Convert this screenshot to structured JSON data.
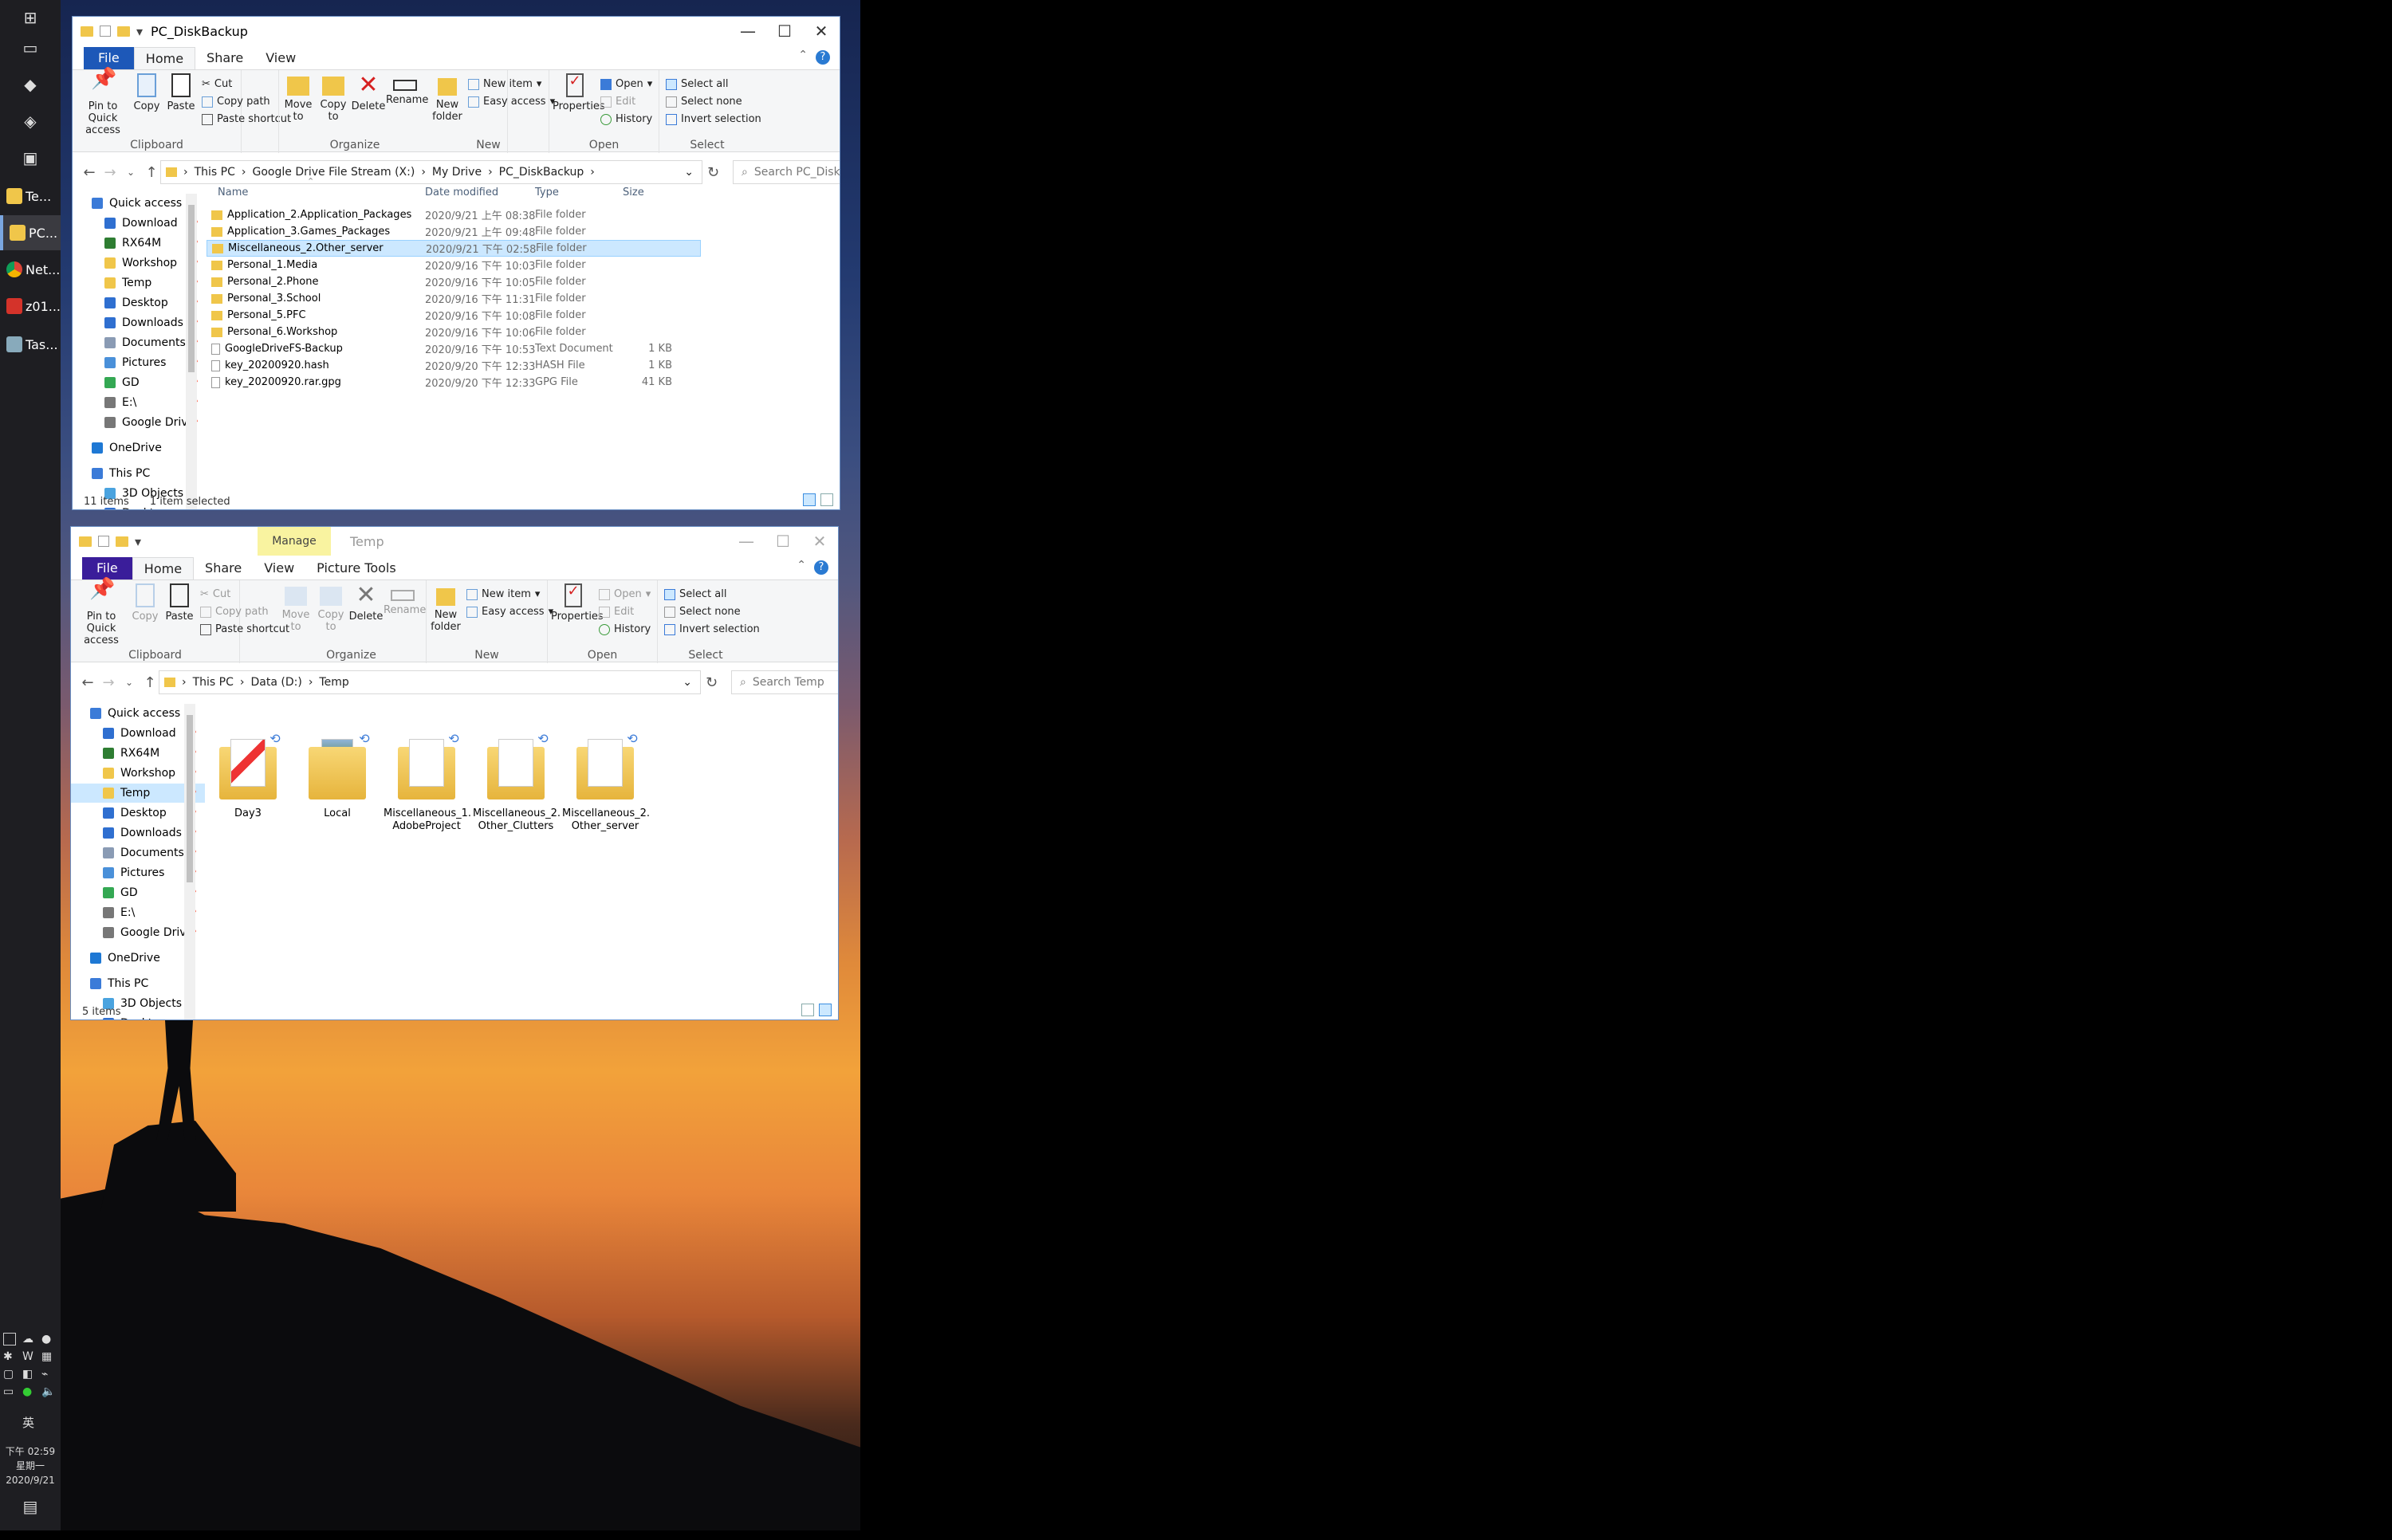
{
  "taskbar": {
    "apps": [
      {
        "label": "Te...",
        "icon": "folder-icon"
      },
      {
        "label": "PC...",
        "icon": "folder-icon"
      },
      {
        "label": "Net...",
        "icon": "chrome-icon"
      },
      {
        "label": "z01...",
        "icon": "pdf-icon"
      },
      {
        "label": "Tas...",
        "icon": "task-manager-icon"
      }
    ],
    "clock": {
      "time": "下午 02:59",
      "day": "星期一",
      "date": "2020/9/21"
    },
    "ime": "英"
  },
  "window1": {
    "title": "PC_DiskBackup",
    "tabs": [
      "File",
      "Home",
      "Share",
      "View"
    ],
    "ribbon": {
      "clipboard": {
        "label": "Clipboard",
        "pin": "Pin to Quick access",
        "copy": "Copy",
        "paste": "Paste",
        "cut": "Cut",
        "copy_path": "Copy path",
        "paste_shortcut": "Paste shortcut"
      },
      "organize": {
        "label": "Organize",
        "move_to": "Move to",
        "copy_to": "Copy to",
        "delete": "Delete",
        "rename": "Rename"
      },
      "new": {
        "label": "New",
        "new_folder": "New folder",
        "new_item": "New item",
        "easy_access": "Easy access"
      },
      "open": {
        "label": "Open",
        "properties": "Properties",
        "open": "Open",
        "edit": "Edit",
        "history": "History"
      },
      "select": {
        "label": "Select",
        "select_all": "Select all",
        "select_none": "Select none",
        "invert": "Invert selection"
      }
    },
    "breadcrumb": [
      "This PC",
      "Google Drive File Stream (X:)",
      "My Drive",
      "PC_DiskBackup"
    ],
    "search_placeholder": "Search PC_DiskBackup",
    "nav": [
      {
        "label": "Quick access",
        "icon": "star-icon",
        "pinned": false
      },
      {
        "label": "Download",
        "icon": "download-icon",
        "pinned": true
      },
      {
        "label": "RX64M",
        "icon": "chip-icon",
        "pinned": true
      },
      {
        "label": "Workshop",
        "icon": "folder-icon",
        "pinned": true
      },
      {
        "label": "Temp",
        "icon": "folder-icon",
        "pinned": true
      },
      {
        "label": "Desktop",
        "icon": "desktop-icon",
        "pinned": true
      },
      {
        "label": "Downloads",
        "icon": "download-icon",
        "pinned": true
      },
      {
        "label": "Documents",
        "icon": "documents-icon",
        "pinned": true
      },
      {
        "label": "Pictures",
        "icon": "pictures-icon",
        "pinned": true
      },
      {
        "label": "GD",
        "icon": "google-drive-icon",
        "pinned": true
      },
      {
        "label": "E:\\",
        "icon": "drive-icon",
        "pinned": true
      },
      {
        "label": "Google Drive",
        "icon": "drive-icon",
        "pinned": true
      },
      {
        "label": "OneDrive",
        "icon": "onedrive-icon",
        "pinned": false
      },
      {
        "label": "This PC",
        "icon": "computer-icon",
        "pinned": false
      },
      {
        "label": "3D Objects",
        "icon": "3d-objects-icon",
        "pinned": false
      },
      {
        "label": "Desktop",
        "icon": "desktop-icon",
        "pinned": false
      }
    ],
    "columns": [
      "Name",
      "Date modified",
      "Type",
      "Size"
    ],
    "files": [
      {
        "name": "Application_2.Application_Packages",
        "date": "2020/9/21 上午 08:38",
        "type": "File folder",
        "size": "",
        "kind": "folder"
      },
      {
        "name": "Application_3.Games_Packages",
        "date": "2020/9/21 上午 09:48",
        "type": "File folder",
        "size": "",
        "kind": "folder"
      },
      {
        "name": "Miscellaneous_2.Other_server",
        "date": "2020/9/21 下午 02:58",
        "type": "File folder",
        "size": "",
        "kind": "folder-sync",
        "selected": true
      },
      {
        "name": "Personal_1.Media",
        "date": "2020/9/16 下午 10:03",
        "type": "File folder",
        "size": "",
        "kind": "folder"
      },
      {
        "name": "Personal_2.Phone",
        "date": "2020/9/16 下午 10:05",
        "type": "File folder",
        "size": "",
        "kind": "folder"
      },
      {
        "name": "Personal_3.School",
        "date": "2020/9/16 下午 11:31",
        "type": "File folder",
        "size": "",
        "kind": "folder"
      },
      {
        "name": "Personal_5.PFC",
        "date": "2020/9/16 下午 10:08",
        "type": "File folder",
        "size": "",
        "kind": "folder"
      },
      {
        "name": "Personal_6.Workshop",
        "date": "2020/9/16 下午 10:06",
        "type": "File folder",
        "size": "",
        "kind": "folder"
      },
      {
        "name": "GoogleDriveFS-Backup",
        "date": "2020/9/16 下午 10:53",
        "type": "Text Document",
        "size": "1 KB",
        "kind": "file"
      },
      {
        "name": "key_20200920.hash",
        "date": "2020/9/20 下午 12:33",
        "type": "HASH File",
        "size": "1 KB",
        "kind": "file"
      },
      {
        "name": "key_20200920.rar.gpg",
        "date": "2020/9/20 下午 12:33",
        "type": "GPG File",
        "size": "41 KB",
        "kind": "file"
      }
    ],
    "status": {
      "count": "11 items",
      "selection": "1 item selected"
    }
  },
  "window2": {
    "title": "Temp",
    "context_tab": "Manage",
    "tabs": [
      "File",
      "Home",
      "Share",
      "View",
      "Picture Tools"
    ],
    "ribbon": {
      "clipboard": {
        "label": "Clipboard",
        "pin": "Pin to Quick access",
        "copy": "Copy",
        "paste": "Paste",
        "cut": "Cut",
        "copy_path": "Copy path",
        "paste_shortcut": "Paste shortcut"
      },
      "organize": {
        "label": "Organize",
        "move_to": "Move to",
        "copy_to": "Copy to",
        "delete": "Delete",
        "rename": "Rename"
      },
      "new": {
        "label": "New",
        "new_folder": "New folder",
        "new_item": "New item",
        "easy_access": "Easy access"
      },
      "open": {
        "label": "Open",
        "properties": "Properties",
        "open": "Open",
        "edit": "Edit",
        "history": "History"
      },
      "select": {
        "label": "Select",
        "select_all": "Select all",
        "select_none": "Select none",
        "invert": "Invert selection"
      }
    },
    "breadcrumb": [
      "This PC",
      "Data (D:)",
      "Temp"
    ],
    "search_placeholder": "Search Temp",
    "nav_selected": "Temp",
    "tiles": [
      {
        "name": "Day3",
        "thumb": "pdf"
      },
      {
        "name": "Local",
        "thumb": "photo"
      },
      {
        "name": "Miscellaneous_1.\nAdobeProject",
        "thumb": "folder"
      },
      {
        "name": "Miscellaneous_2.\nOther_Clutters",
        "thumb": "folder"
      },
      {
        "name": "Miscellaneous_2.\nOther_server",
        "thumb": "folder"
      }
    ],
    "status": {
      "count": "5 items"
    }
  },
  "colors": {
    "accent": "#1d58b8",
    "selection": "#cce8ff",
    "folder": "#f0c64a",
    "taskbar": "#1e1e22"
  }
}
